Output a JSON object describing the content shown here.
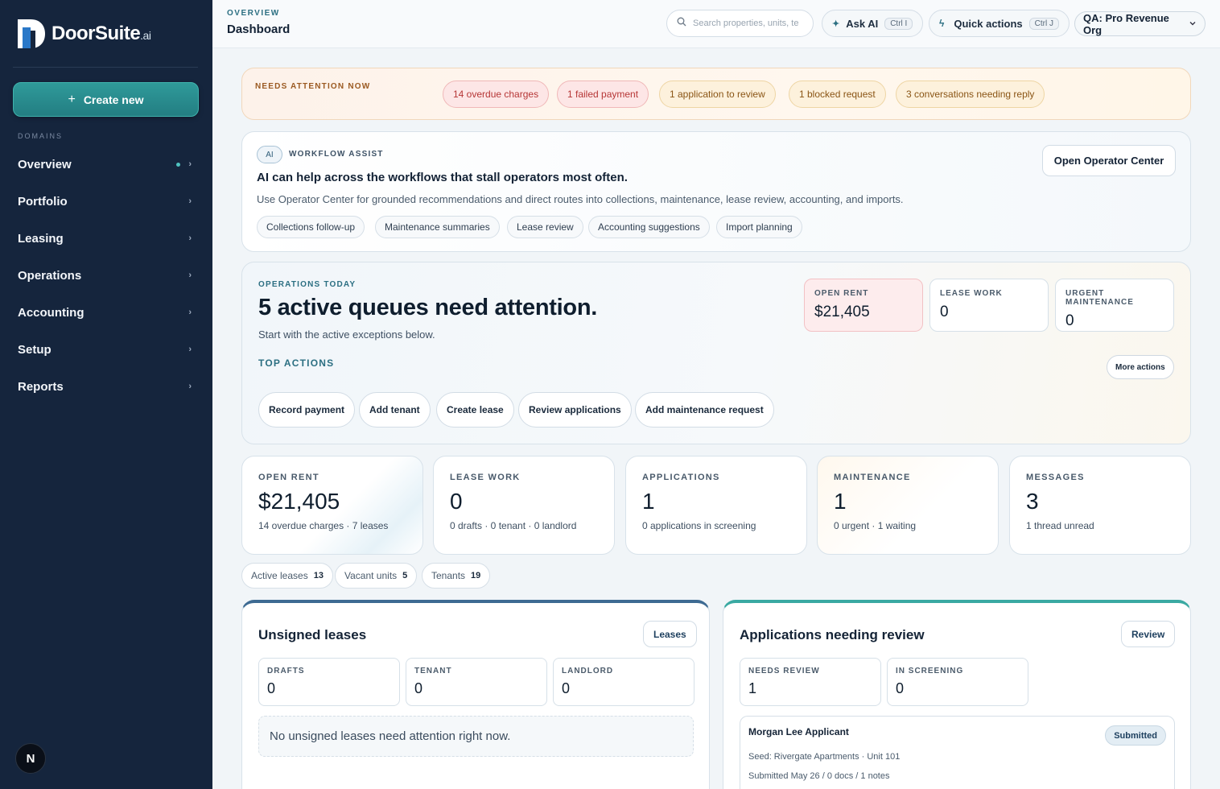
{
  "brand": {
    "name": "DoorSuite",
    "suffix": ".ai"
  },
  "sidebar": {
    "create_label": "Create new",
    "domains_label": "DOMAINS",
    "items": [
      {
        "label": "Overview",
        "active": true
      },
      {
        "label": "Portfolio"
      },
      {
        "label": "Leasing"
      },
      {
        "label": "Operations"
      },
      {
        "label": "Accounting"
      },
      {
        "label": "Setup"
      },
      {
        "label": "Reports"
      }
    ],
    "user_initial": "N"
  },
  "header": {
    "breadcrumb": "OVERVIEW",
    "title": "Dashboard",
    "search_placeholder": "Search properties, units, te",
    "ask_ai_label": "Ask AI",
    "ask_ai_shortcut": "Ctrl I",
    "quick_actions_label": "Quick actions",
    "quick_actions_shortcut": "Ctrl J",
    "org_label": "QA: Pro Revenue Org"
  },
  "attention": {
    "label": "NEEDS ATTENTION NOW",
    "pills": [
      "14 overdue charges",
      "1 failed payment",
      "1 application to review",
      "1 blocked request",
      "3 conversations needing reply"
    ]
  },
  "assist": {
    "chip": "AI",
    "label": "WORKFLOW ASSIST",
    "title": "AI can help across the workflows that stall operators most often.",
    "description": "Use Operator Center for grounded recommendations and direct routes into collections, maintenance, lease review, accounting, and imports.",
    "button": "Open Operator Center",
    "chips": [
      "Collections follow-up",
      "Maintenance summaries",
      "Lease review",
      "Accounting suggestions",
      "Import planning"
    ]
  },
  "ops": {
    "label": "OPERATIONS TODAY",
    "title": "5 active queues need attention.",
    "subtitle": "Start with the active exceptions below.",
    "top_actions_label": "TOP ACTIONS",
    "more_actions": "More actions",
    "actions": [
      "Record payment",
      "Add tenant",
      "Create lease",
      "Review applications",
      "Add maintenance request"
    ],
    "minis": [
      {
        "label": "OPEN RENT",
        "value": "$21,405"
      },
      {
        "label": "LEASE WORK",
        "value": "0"
      },
      {
        "label": "URGENT MAINTENANCE",
        "value": "0"
      }
    ]
  },
  "stats": [
    {
      "label": "OPEN RENT",
      "value": "$21,405",
      "sub": "14 overdue charges · 7 leases"
    },
    {
      "label": "LEASE WORK",
      "value": "0",
      "sub": "0 drafts · 0 tenant · 0 landlord"
    },
    {
      "label": "APPLICATIONS",
      "value": "1",
      "sub": "0 applications in screening"
    },
    {
      "label": "MAINTENANCE",
      "value": "1",
      "sub": "0 urgent · 1 waiting"
    },
    {
      "label": "MESSAGES",
      "value": "3",
      "sub": "1 thread unread"
    }
  ],
  "counts": [
    {
      "label": "Active leases",
      "value": "13"
    },
    {
      "label": "Vacant units",
      "value": "5"
    },
    {
      "label": "Tenants",
      "value": "19"
    }
  ],
  "leases_panel": {
    "title": "Unsigned leases",
    "button": "Leases",
    "boxes": [
      {
        "label": "DRAFTS",
        "value": "0"
      },
      {
        "label": "TENANT",
        "value": "0"
      },
      {
        "label": "LANDLORD",
        "value": "0"
      }
    ],
    "empty": "No unsigned leases need attention right now."
  },
  "apps_panel": {
    "title": "Applications needing review",
    "button": "Review",
    "boxes": [
      {
        "label": "NEEDS REVIEW",
        "value": "1"
      },
      {
        "label": "IN SCREENING",
        "value": "0"
      }
    ],
    "item": {
      "name": "Morgan Lee Applicant",
      "status": "Submitted",
      "meta1": "Seed: Rivergate Apartments · Unit 101",
      "meta2": "Submitted May 26 / 0 docs / 1 notes"
    }
  },
  "colors": {
    "sidebar": "#15253d",
    "accent": "#2f9a9a",
    "danger": "#b63636",
    "warning": "#8a5515"
  }
}
